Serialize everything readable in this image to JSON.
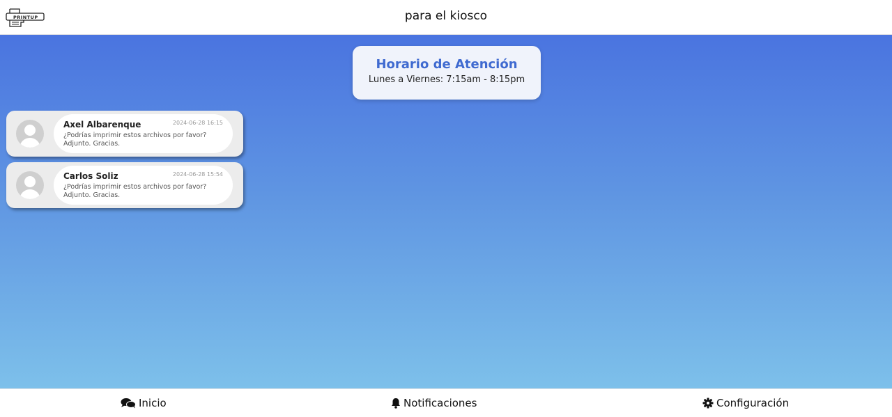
{
  "header": {
    "logo_text": "PRINTUP",
    "title": "para el kiosco"
  },
  "hours_card": {
    "title": "Horario de Atención",
    "schedule": "Lunes a Viernes: 7:15am - 8:15pm"
  },
  "messages": [
    {
      "sender": "Axel Albarenque",
      "time": "2024-06-28 16:15",
      "text": "¿Podrías imprimir estos archivos por favor? Adjunto. Gracias."
    },
    {
      "sender": "Carlos Soliz",
      "time": "2024-06-28 15:54",
      "text": "¿Podrías imprimir estos archivos por favor? Adjunto. Gracias."
    }
  ],
  "bottom_nav": {
    "items": [
      {
        "label": "Inicio",
        "icon": "comments-icon"
      },
      {
        "label": "Notificaciones",
        "icon": "bell-icon"
      },
      {
        "label": "Configuración",
        "icon": "gear-icon"
      }
    ]
  },
  "colors": {
    "gradient_top": "#4a74e0",
    "gradient_bottom": "#7dc0ea",
    "accent": "#3f6ad0"
  }
}
